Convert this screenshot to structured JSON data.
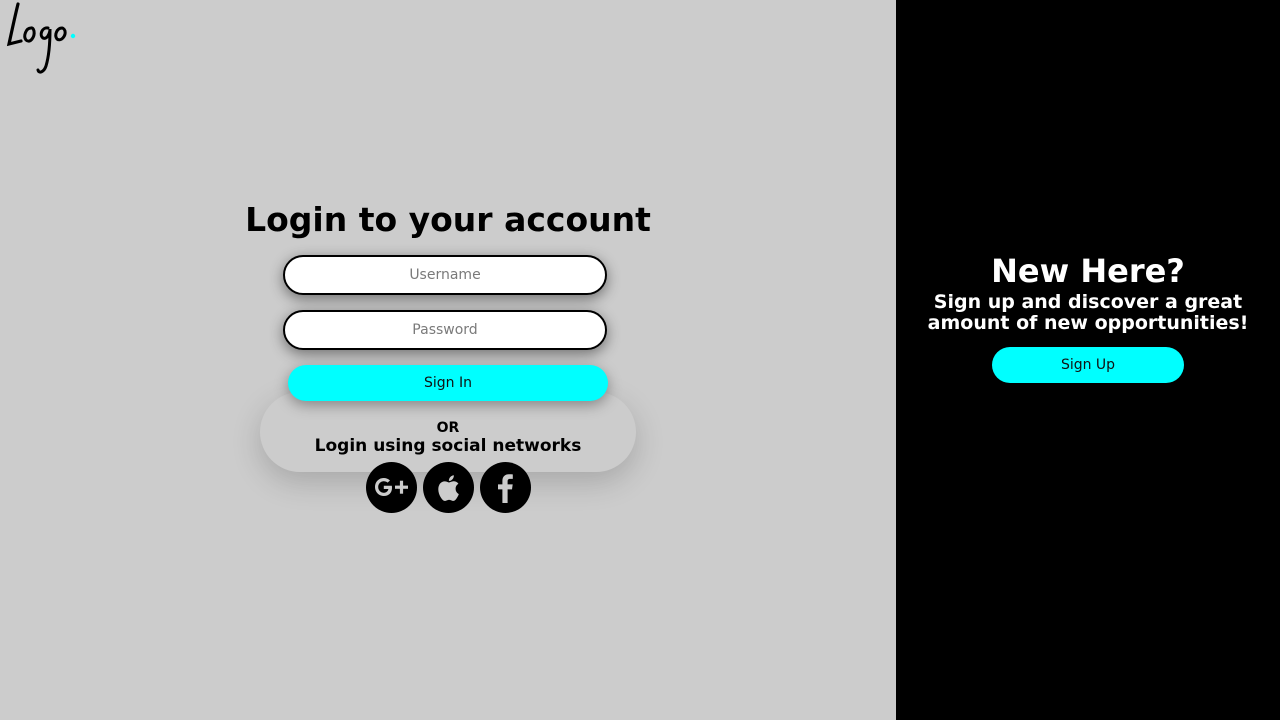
{
  "brand": {
    "logo_text": "Logo",
    "accent_color": "#00ffff"
  },
  "login": {
    "title": "Login to your account",
    "username_placeholder": "Username",
    "password_placeholder": "Password",
    "signin_label": "Sign In",
    "or_label": "OR",
    "social_label": "Login using social networks",
    "socials": [
      {
        "name": "google-plus-icon"
      },
      {
        "name": "apple-icon"
      },
      {
        "name": "facebook-icon"
      }
    ]
  },
  "signup_panel": {
    "title": "New Here?",
    "subtitle": "Sign up and discover a great amount of new opportunities!",
    "signup_label": "Sign Up"
  },
  "colors": {
    "left_bg": "#cccccc",
    "right_bg": "#000000"
  }
}
